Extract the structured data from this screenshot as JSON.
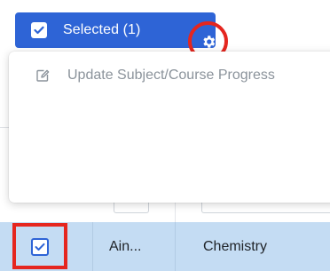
{
  "toolbar": {
    "selected_label": "Selected (1)",
    "accent_color": "#2e64d6",
    "highlight_color": "#e5261f",
    "check_icon": "check-icon",
    "settings_icon": "gear-icon"
  },
  "menu": {
    "items": [
      {
        "label": "Update Subject/Course Progress",
        "icon": "edit-icon",
        "enabled": false
      }
    ]
  },
  "table": {
    "selected_row": {
      "checked": true,
      "name": "Ain...",
      "subject": "Chemistry",
      "row_color": "#c4dcf3"
    }
  }
}
